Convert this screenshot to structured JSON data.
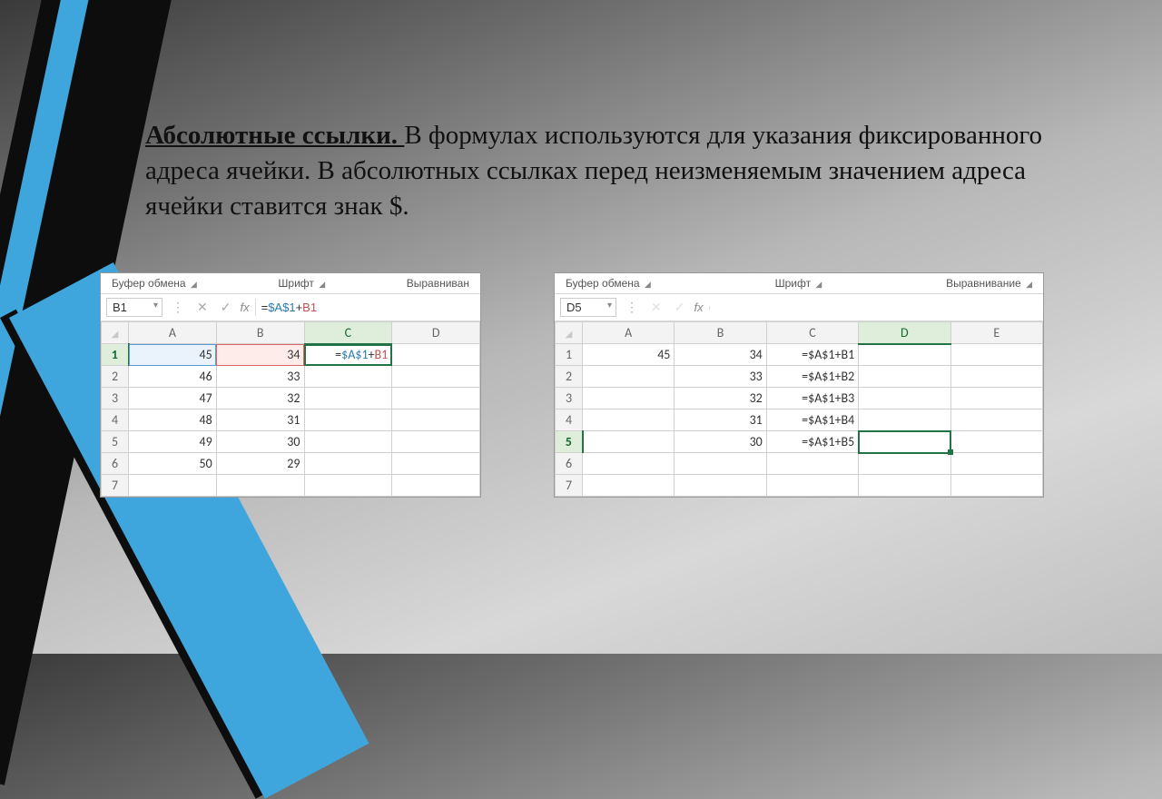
{
  "slide": {
    "title": "Абсолютные ссылки. ",
    "body": "В формулах используются для указания фиксированного адреса ячейки. В абсолютных ссылках перед неизменяемым значением адреса ячейки ставится знак $."
  },
  "ribbon": {
    "clipboard": "Буфер обмена",
    "font": "Шрифт",
    "alignment_short": "Выравниван",
    "alignment": "Выравнивание"
  },
  "left": {
    "namebox": "B1",
    "formula_prefix": "=",
    "formula_ref_a": "$A$1",
    "formula_plus": "+",
    "formula_ref_b": "B1",
    "columns": [
      "A",
      "B",
      "C",
      "D"
    ],
    "rows": [
      "1",
      "2",
      "3",
      "4",
      "5",
      "6",
      "7"
    ],
    "data": {
      "A": [
        "45",
        "46",
        "47",
        "48",
        "49",
        "50",
        ""
      ],
      "B": [
        "34",
        "33",
        "32",
        "31",
        "30",
        "29",
        ""
      ]
    },
    "edit_cell_text": "=$A$1+B1"
  },
  "right": {
    "namebox": "D5",
    "formula": "",
    "columns": [
      "A",
      "B",
      "C",
      "D",
      "E"
    ],
    "rows": [
      "1",
      "2",
      "3",
      "4",
      "5",
      "6",
      "7"
    ],
    "data": {
      "A": [
        "45",
        "",
        "",
        "",
        "",
        "",
        ""
      ],
      "B": [
        "34",
        "33",
        "32",
        "31",
        "30",
        "",
        ""
      ],
      "C": [
        "=$A$1+B1",
        "=$A$1+B2",
        "=$A$1+B3",
        "=$A$1+B4",
        "=$A$1+B5",
        "",
        ""
      ]
    }
  }
}
